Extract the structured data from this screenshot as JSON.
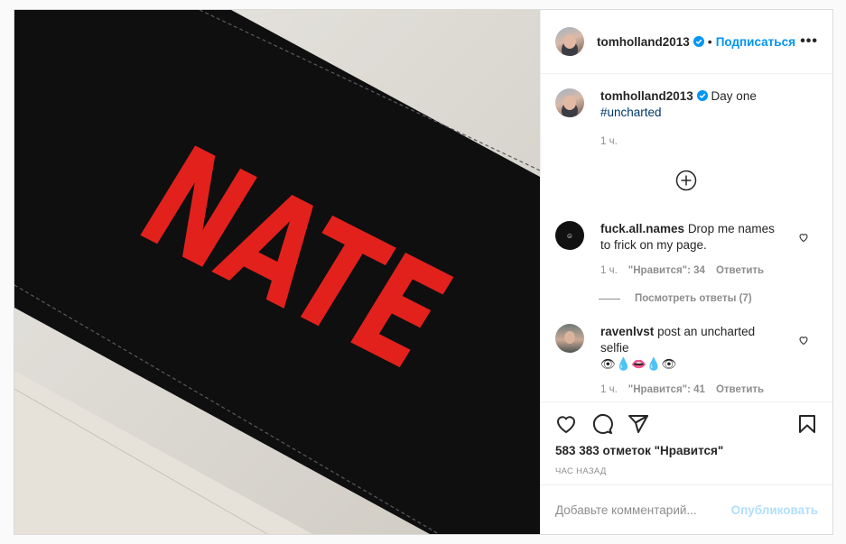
{
  "post": {
    "author": {
      "username": "tomholland2013",
      "verified": true
    },
    "follow_label": "Подписаться",
    "separator": "•",
    "more_label": "•••",
    "image": {
      "description_text": "NATE"
    },
    "caption": {
      "username": "tomholland2013",
      "text": "Day one",
      "hashtag": "#uncharted",
      "age": "1 ч."
    },
    "comments": [
      {
        "username": "fuck.all.names",
        "text": "Drop me names to frick on my page.",
        "age": "1 ч.",
        "likes": "\"Нравится\": 34",
        "reply": "Ответить",
        "view_replies": "Посмотреть ответы (7)",
        "avatar_text": "☺"
      },
      {
        "username": "ravenlvst",
        "text": "post an uncharted selfie",
        "emojis": "👁💧👄💧👁",
        "age": "1 ч.",
        "likes": "\"Нравится\": 41",
        "reply": "Ответить"
      }
    ],
    "likes_count": "583 383 отметок \"Нравится\"",
    "posted": "час назад",
    "comment_placeholder": "Добавьте комментарий...",
    "publish_label": "Опубликовать"
  },
  "colors": {
    "accent": "#0095f6",
    "publish_disabled": "#b2dffc",
    "muted": "#8e8e8e",
    "fabric": "#0f0f10",
    "logo_red": "#e3211c"
  },
  "icons": [
    "verified-badge-icon",
    "more-options-icon",
    "plus-circle-icon",
    "heart-icon",
    "comment-icon",
    "share-icon",
    "bookmark-icon"
  ]
}
